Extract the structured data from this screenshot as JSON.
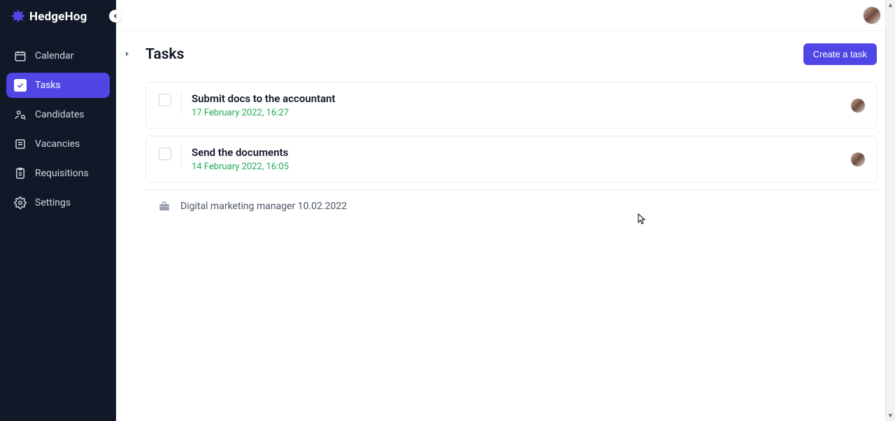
{
  "brand": {
    "name": "HedgeHog"
  },
  "sidebar": {
    "items": [
      {
        "label": "Calendar"
      },
      {
        "label": "Tasks"
      },
      {
        "label": "Candidates"
      },
      {
        "label": "Vacancies"
      },
      {
        "label": "Requisitions"
      },
      {
        "label": "Settings"
      }
    ]
  },
  "page": {
    "title": "Tasks",
    "create_button": "Create a task"
  },
  "tasks": [
    {
      "title": "Submit docs to the accountant",
      "date": "17 February 2022, 16:27"
    },
    {
      "title": "Send the documents",
      "date": "14 February 2022, 16:05"
    }
  ],
  "subtask": {
    "label": "Digital marketing manager 10.02.2022"
  }
}
